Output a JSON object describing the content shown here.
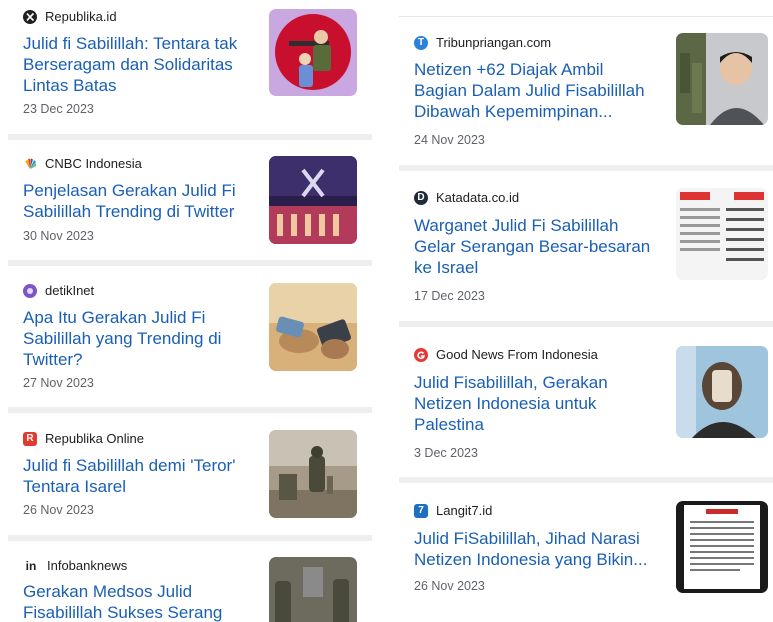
{
  "left": [
    {
      "source": "Republika.id",
      "icon": "republika-icon",
      "title_lines": [
        "Julid fi Sabilillah: Tentara tak",
        "Berseragam dan Solidaritas",
        "Lintas Batas"
      ],
      "date": "23 Dec 2023"
    },
    {
      "source": "CNBC Indonesia",
      "icon": "cnbc-peacock-icon",
      "title_lines": [
        "Penjelasan Gerakan Julid Fi",
        "Sabilillah Trending di Twitter"
      ],
      "date": "30 Nov 2023"
    },
    {
      "source": "detikInet",
      "icon": "detik-icon",
      "title_lines": [
        "Apa Itu Gerakan Julid Fi",
        "Sabilillah yang Trending di",
        "Twitter?"
      ],
      "date": "27 Nov 2023"
    },
    {
      "source": "Republika Online",
      "icon": "republika-r-icon",
      "title_lines": [
        "Julid fi Sabilillah demi 'Teror'",
        "Tentara Isarel"
      ],
      "date": "26 Nov 2023"
    },
    {
      "source": "Infobanknews",
      "icon": "infobank-icon",
      "title_lines": [
        "Gerakan Medsos Julid",
        "Fisabilillah Sukses Serang"
      ],
      "date": ""
    }
  ],
  "right": [
    {
      "source": "Tribunpriangan.com",
      "icon": "tribun-icon",
      "title_lines": [
        "Netizen +62 Diajak Ambil",
        "Bagian Dalam Julid Fisabilillah",
        "Dibawah Kepemimpinan..."
      ],
      "date": "24 Nov 2023"
    },
    {
      "source": "Katadata.co.id",
      "icon": "katadata-icon",
      "title_lines": [
        "Warganet Julid Fi Sabilillah",
        "Gelar Serangan Besar-besaran",
        "ke Israel"
      ],
      "date": "17 Dec 2023"
    },
    {
      "source": "Good News From Indonesia",
      "icon": "goodnews-icon",
      "title_lines": [
        "Julid Fisabilillah, Gerakan",
        "Netizen Indonesia untuk",
        "Palestina"
      ],
      "date": "3 Dec 2023"
    },
    {
      "source": "Langit7.id",
      "icon": "langit7-icon",
      "title_lines": [
        "Julid FiSabilillah, Jihad Narasi",
        "Netizen Indonesia yang Bikin..."
      ],
      "date": "26 Nov 2023"
    }
  ],
  "icon_glyphs": {
    "republika_r": "R",
    "infobank": "in",
    "langit7": "7",
    "katadata": "D",
    "tribun": "T"
  },
  "colors": {
    "link": "#1a5fb4",
    "meta": "#5f6368",
    "separator": "#eeeeee",
    "republika_red": "#e03b2f",
    "langit_blue": "#1d6fc2",
    "katadata_dark": "#1e2a3a",
    "detik_purple": "#7b57c4",
    "tribun_blue": "#2b82d9"
  }
}
